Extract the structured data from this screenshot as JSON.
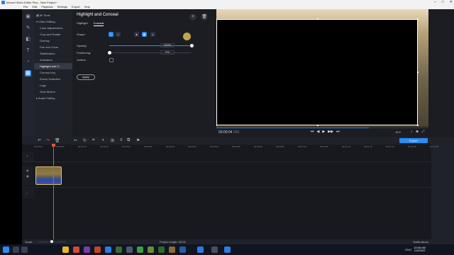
{
  "window": {
    "title": "Movavi Video Editor Plus - New Project *",
    "buttons": [
      "–",
      "□",
      "✕"
    ]
  },
  "menu": [
    "File",
    "Edit",
    "Playback",
    "Settings",
    "Export",
    "Help"
  ],
  "rail_icons": [
    "import-icon",
    "filters-icon",
    "transitions-icon",
    "titles-icon",
    "stickers-icon",
    "more-tools-icon"
  ],
  "tools": {
    "all_tools": "All Tools",
    "video_editing": "Video Editing",
    "items": [
      "Color Adjustments",
      "Crop and Rotate",
      "Overlay",
      "Pan and Zoom",
      "Stabilization",
      "Animation",
      "Highlight and C...",
      "Chroma Key",
      "Scene Detection",
      "Logo",
      "Slow Motion"
    ],
    "audio_editing": "Audio Editing"
  },
  "panel": {
    "title": "Highlight and Conceal",
    "tabs": [
      "Highlight",
      "Conceal"
    ],
    "active_tab": "Conceal",
    "shape_label": "Shape:",
    "opacity_label": "Opacity:",
    "opacity_value": "100%",
    "opacity_fraction": 1.0,
    "feathering_label": "Feathering:",
    "feathering_value": "0%",
    "feathering_fraction": 0.0,
    "outline_label": "Outline:",
    "apply_label": "Apply",
    "add_icon": "+",
    "delete_icon": "🗑"
  },
  "player": {
    "time": "00:00:04",
    "time_ms": "000",
    "progress_fraction": 0.72,
    "aspect": "16:9",
    "controls": [
      "⏮",
      "◀",
      "▶",
      "▶▶",
      "⏭"
    ]
  },
  "timeline": {
    "toolbar_icons": [
      "undo-icon",
      "redo-icon",
      "delete-icon",
      "cut-icon",
      "rotate-icon",
      "crop-icon",
      "color-icon",
      "insert-icon",
      "marker-icon",
      "transition-icon",
      "flag-icon"
    ],
    "export_label": "Export",
    "ruler": [
      "00:00:00",
      "00:00:05",
      "00:00:10",
      "00:00:15",
      "00:00:20",
      "00:00:25",
      "00:00:30",
      "00:00:35",
      "00:00:40",
      "00:00:45",
      "00:00:50",
      "00:00:55",
      "00:01:00",
      "00:01:05",
      "00:01:10",
      "00:01:15",
      "00:01:20",
      "00:01:25",
      "00:01:30"
    ]
  },
  "status": {
    "scale_label": "Scale:",
    "project_length": "Project length: 00:06",
    "notifications": "Notifications"
  },
  "taskbar": {
    "time": "10:08 AM",
    "date": "1/4/2022",
    "tray": "ENG"
  }
}
